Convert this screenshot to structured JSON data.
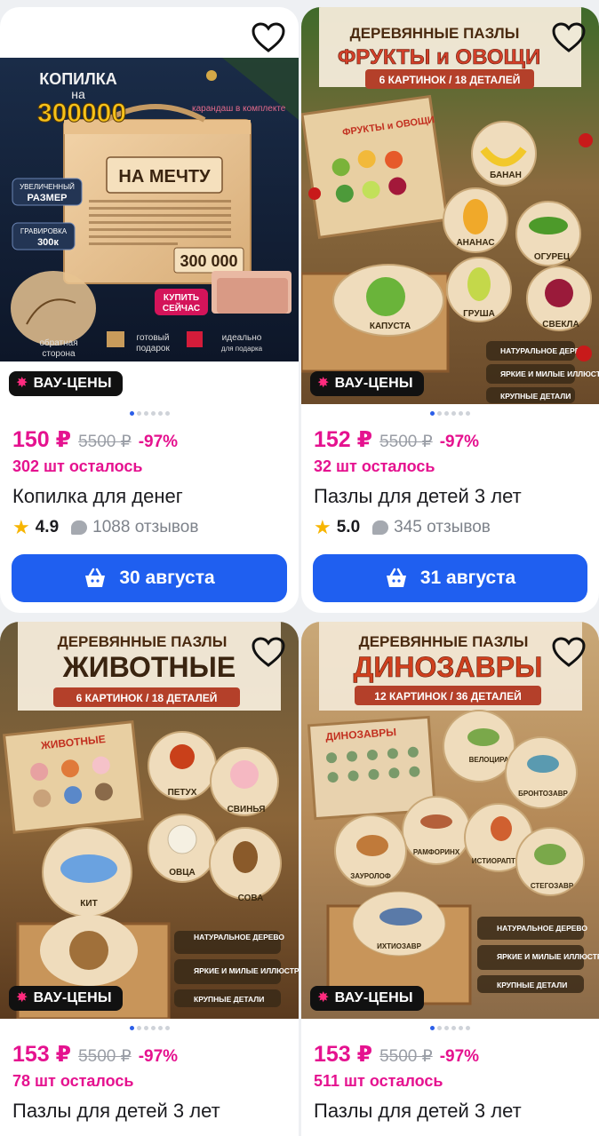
{
  "badge_label": "ВАУ-ЦЕНЫ",
  "products": [
    {
      "price": "150 ₽",
      "old_price": "5500 ₽",
      "discount": "-97%",
      "stock": "302 шт осталось",
      "title": "Копилка для денег",
      "rating": "4.9",
      "reviews": "1088 отзывов",
      "delivery": "30 августа",
      "image": {
        "top_text": "КОПИЛКА",
        "top_text2": "на",
        "amount": "300000",
        "pencil_note": "карандаш в комплекте",
        "sign": "НА МЕЧТУ",
        "sign_amount": "300 000",
        "tag1_a": "УВЕЛИЧЕННЫЙ",
        "tag1_b": "РАЗМЕР",
        "tag2_a": "ГРАВИРОВКА",
        "tag2_b": "300к",
        "cta_a": "КУПИТЬ",
        "cta_b": "СЕЙЧАС",
        "back_a": "обратная",
        "back_b": "сторона",
        "gift_a": "готовый",
        "gift_b": "подарок",
        "ideal_a": "идеально",
        "ideal_b": "для подарка"
      }
    },
    {
      "price": "152 ₽",
      "old_price": "5500 ₽",
      "discount": "-97%",
      "stock": "32 шт осталось",
      "title": "Пазлы для детей 3 лет",
      "rating": "5.0",
      "reviews": "345 отзывов",
      "delivery": "31 августа",
      "image": {
        "header_a": "ДЕРЕВЯННЫЕ ПАЗЛЫ",
        "header_b": "ФРУКТЫ и ОВОЩИ",
        "count": "6 КАРТИНОК / 18 ДЕТАЛЕЙ",
        "box": "ФРУКТЫ и ОВОЩИ",
        "pieces": [
          "БАНАН",
          "АНАНАС",
          "ОГУРЕЦ",
          "КАПУСТА",
          "ГРУША",
          "СВЕКЛА"
        ],
        "features": [
          "НАТУРАЛЬНОЕ ДЕРЕВО",
          "ЯРКИЕ И МИЛЫЕ ИЛЛЮСТРАЦИИ",
          "КРУПНЫЕ ДЕТАЛИ"
        ]
      }
    },
    {
      "price": "153 ₽",
      "old_price": "5500 ₽",
      "discount": "-97%",
      "stock": "78 шт осталось",
      "title": "Пазлы для детей 3 лет",
      "image": {
        "header_a": "ДЕРЕВЯННЫЕ ПАЗЛЫ",
        "header_b": "ЖИВОТНЫЕ",
        "count": "6 КАРТИНОК / 18 ДЕТАЛЕЙ",
        "box": "ЖИВОТНЫЕ",
        "pieces": [
          "ПЕТУХ",
          "СВИНЬЯ",
          "ОВЦА",
          "СОВА",
          "КИТ"
        ],
        "features": [
          "НАТУРАЛЬНОЕ ДЕРЕВО",
          "ЯРКИЕ И МИЛЫЕ ИЛЛЮСТРАЦИИ",
          "КРУПНЫЕ ДЕТАЛИ"
        ]
      }
    },
    {
      "price": "153 ₽",
      "old_price": "5500 ₽",
      "discount": "-97%",
      "stock": "511 шт осталось",
      "title": "Пазлы для детей 3 лет",
      "image": {
        "header_a": "ДЕРЕВЯННЫЕ ПАЗЛЫ",
        "header_b": "ДИНОЗАВРЫ",
        "count": "12 КАРТИНОК / 36 ДЕТАЛЕЙ",
        "box": "ДИНОЗАВРЫ",
        "pieces": [
          "ВЕЛОЦИРАПТОР",
          "БРОНТОЗАВР",
          "РАМФОРИНХ",
          "ИСТИОРАПТОР",
          "ЗАУРОЛОФ",
          "СТЕГОЗАВР",
          "ИХТИОЗАВР"
        ],
        "features": [
          "НАТУРАЛЬНОЕ ДЕРЕВО",
          "ЯРКИЕ И МИЛЫЕ ИЛЛЮСТРАЦИИ",
          "КРУПНЫЕ ДЕТАЛИ"
        ]
      }
    }
  ],
  "colors": {
    "accent": "#e5128f",
    "button": "#1f5ff0",
    "star": "#f7b500"
  }
}
